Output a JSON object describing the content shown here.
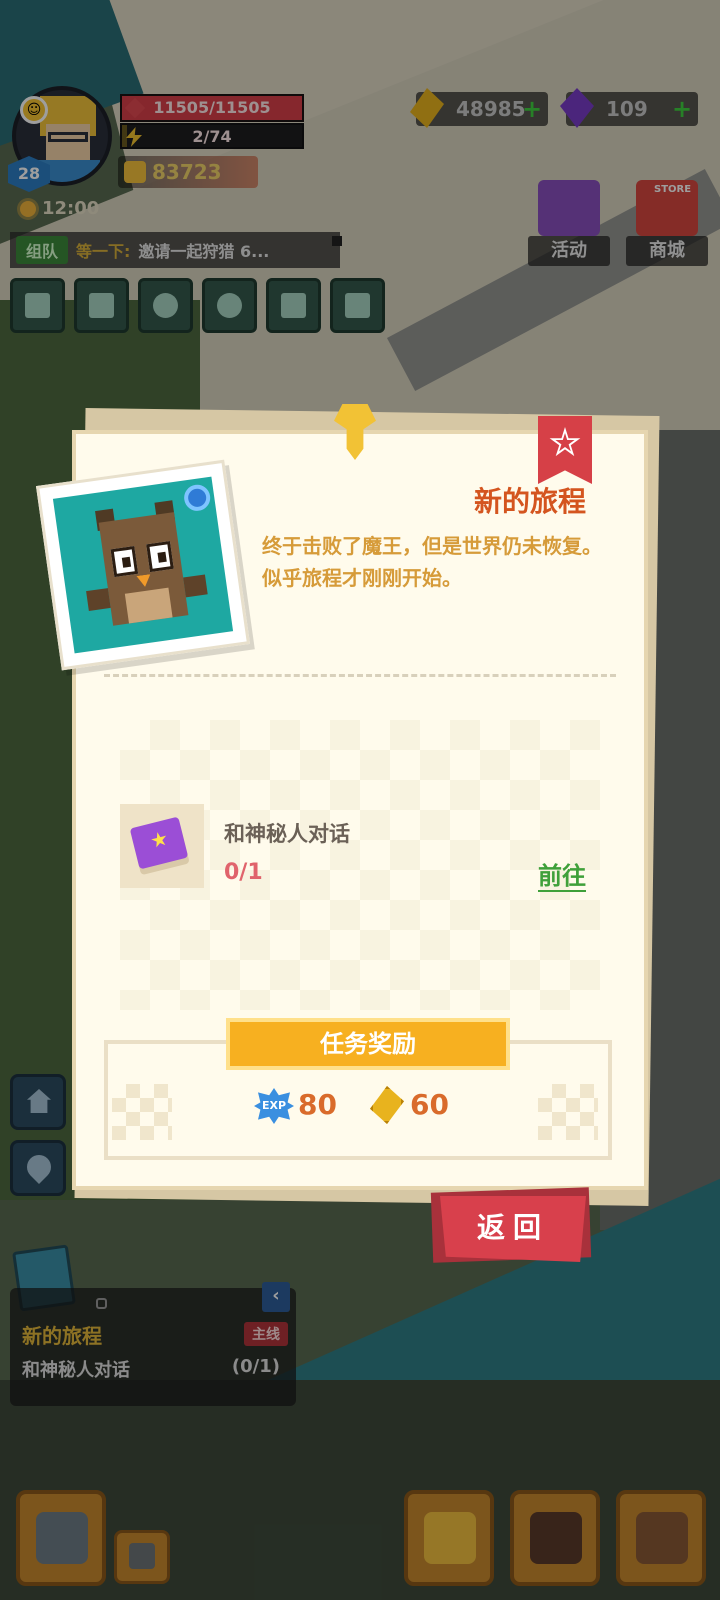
{
  "player": {
    "level": "28",
    "hp": "11505/11505",
    "hp_fraction": 1.0,
    "xp": "2/74",
    "xp_fraction": 0.027,
    "power": "83723",
    "time": "12:00"
  },
  "currencies": {
    "gold": "48985",
    "gems": "109"
  },
  "shortcuts": {
    "events_label": "活动",
    "store_label": "商城",
    "store_sign": "STORE"
  },
  "chat": {
    "tag": "组队",
    "sender": "等一下:",
    "message": "邀请一起狩猎 6..."
  },
  "quest_modal": {
    "title": "新的旅程",
    "description": "终于击败了魔王，但是世界仍未恢复。似乎旅程才刚刚开始。",
    "task_name": "和神秘人对话",
    "task_progress": "0/1",
    "goto_label": "前往",
    "reward_header": "任务奖励",
    "reward_exp_label": "EXP",
    "reward_exp": "80",
    "reward_gold": "60",
    "back_label": "返回"
  },
  "tracker": {
    "title": "新的旅程",
    "badge": "主线",
    "task": "和神秘人对话",
    "progress": "(0/1)",
    "collapse_glyph": "‹"
  },
  "colors": {
    "accent_orange": "#f7b020",
    "title_orange": "#d4551f",
    "progress_red": "#e0636c",
    "goto_green": "#3fa03a",
    "back_red": "#d8404c"
  }
}
